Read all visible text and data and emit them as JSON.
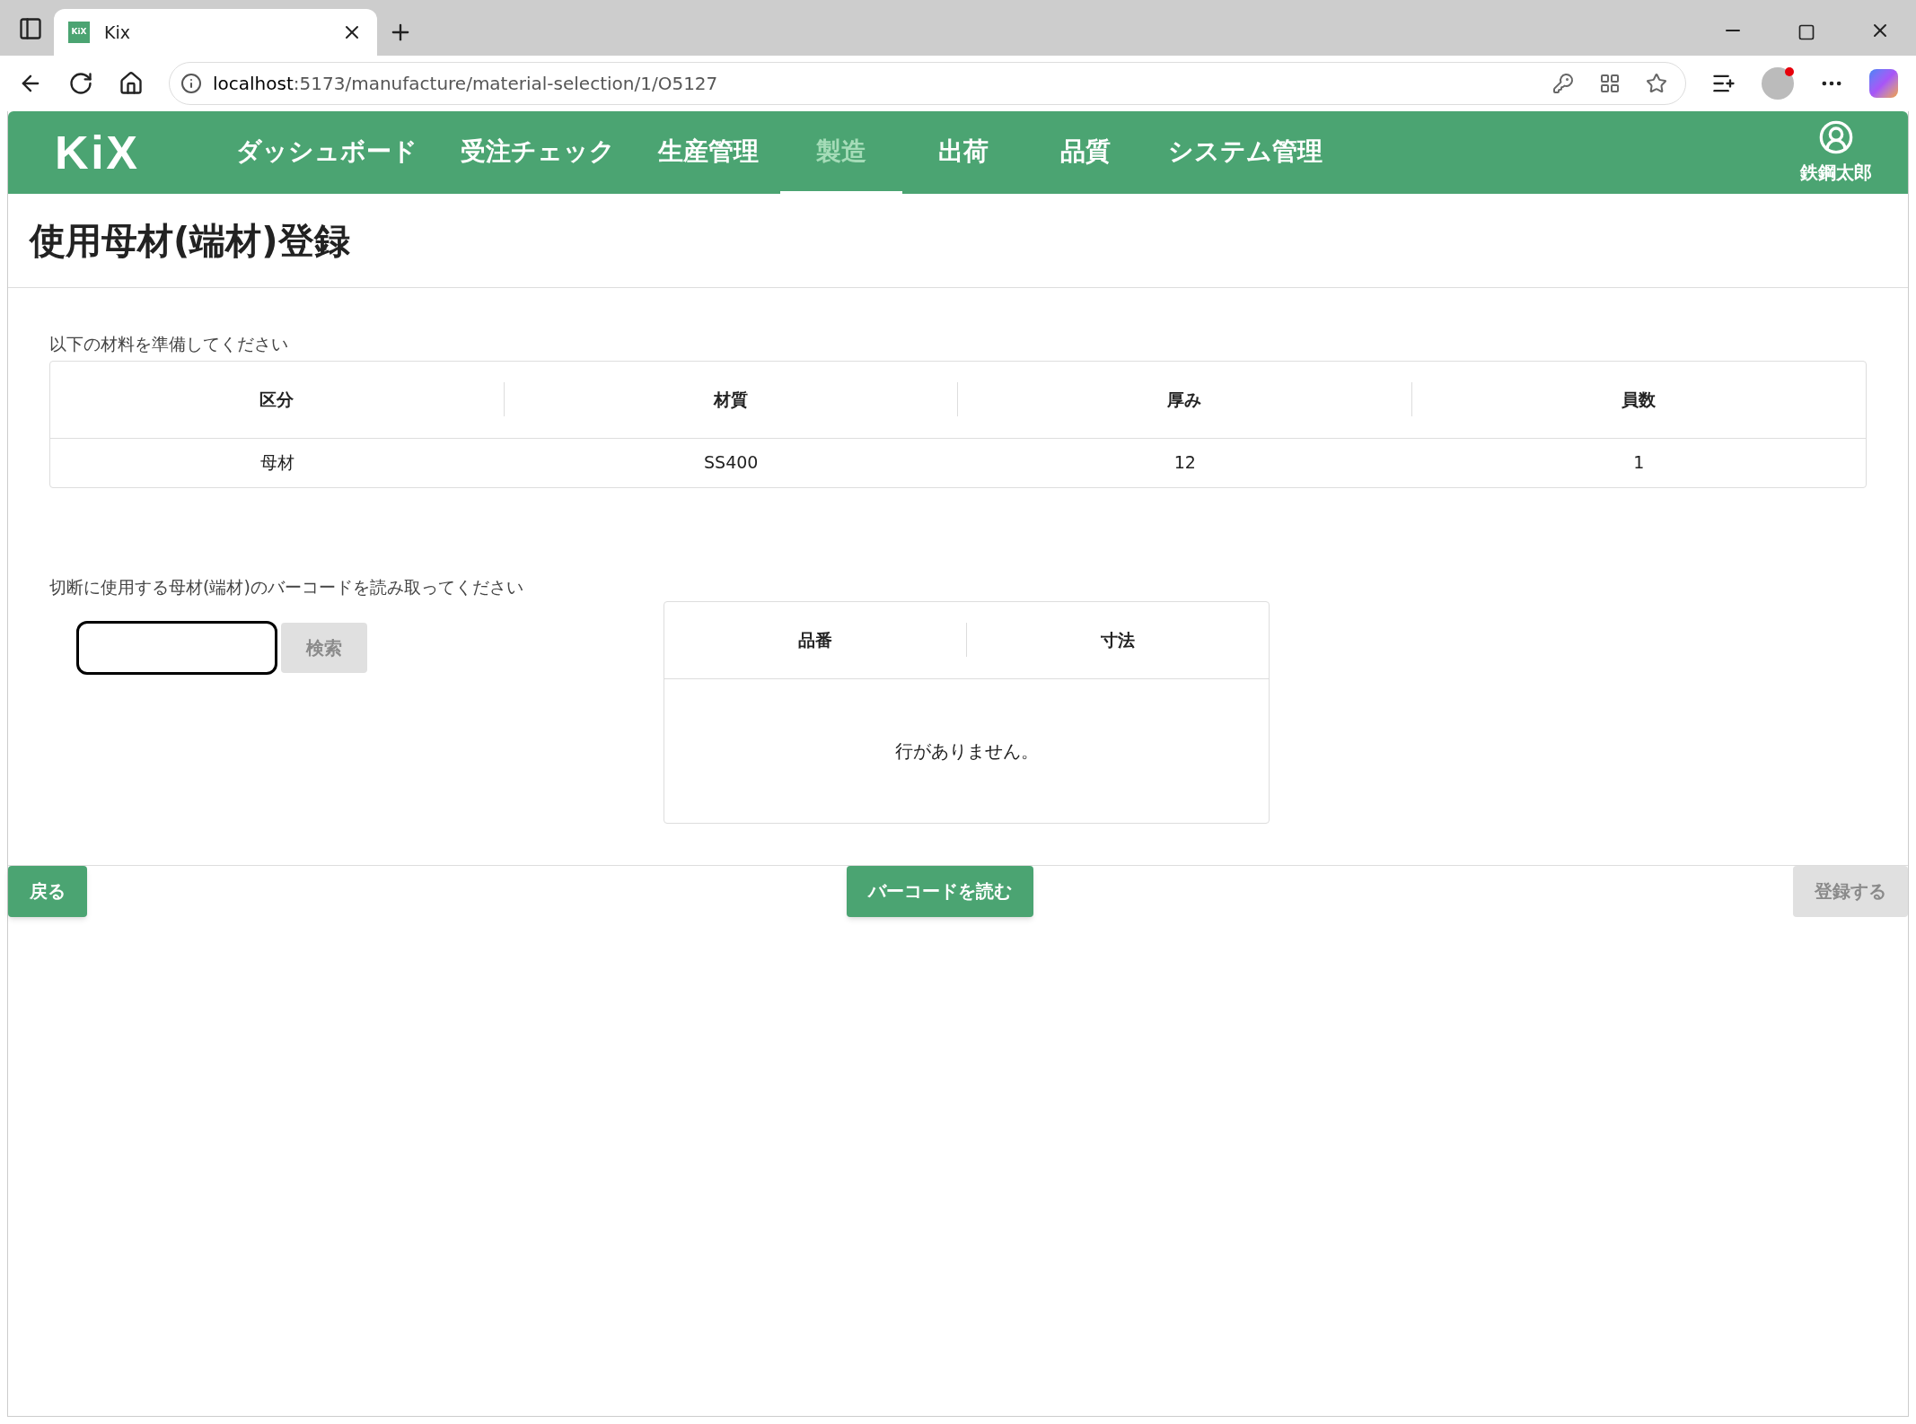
{
  "browser": {
    "tab": {
      "icon_text": "KiX",
      "title": "Kix"
    },
    "url_host": "localhost",
    "url_path": ":5173/manufacture/material-selection/1/O5127"
  },
  "header": {
    "logo": "KiX",
    "nav": [
      {
        "label": "ダッシュボード",
        "selected": false
      },
      {
        "label": "受注チェック",
        "selected": false
      },
      {
        "label": "生産管理",
        "selected": false
      },
      {
        "label": "製造",
        "selected": true
      },
      {
        "label": "出荷",
        "selected": false
      },
      {
        "label": "品質",
        "selected": false
      },
      {
        "label": "システム管理",
        "selected": false
      }
    ],
    "user": "鉄鋼太郎"
  },
  "page_title": "使用母材(端材)登録",
  "materials": {
    "label": "以下の材料を準備してください",
    "columns": [
      "区分",
      "材質",
      "厚み",
      "員数"
    ],
    "rows": [
      [
        "母材",
        "SS400",
        "12",
        "1"
      ]
    ]
  },
  "barcode": {
    "label": "切断に使用する母材(端材)のバーコードを読み取ってください",
    "search_button": {
      "label": "検索",
      "disabled": true
    }
  },
  "scanned": {
    "columns": [
      "品番",
      "寸法"
    ],
    "empty_message": "行がありません。"
  },
  "footer_buttons": [
    {
      "label": "戻る",
      "disabled": false
    },
    {
      "label": "バーコードを読む",
      "disabled": false
    },
    {
      "label": "登録する",
      "disabled": true
    }
  ]
}
